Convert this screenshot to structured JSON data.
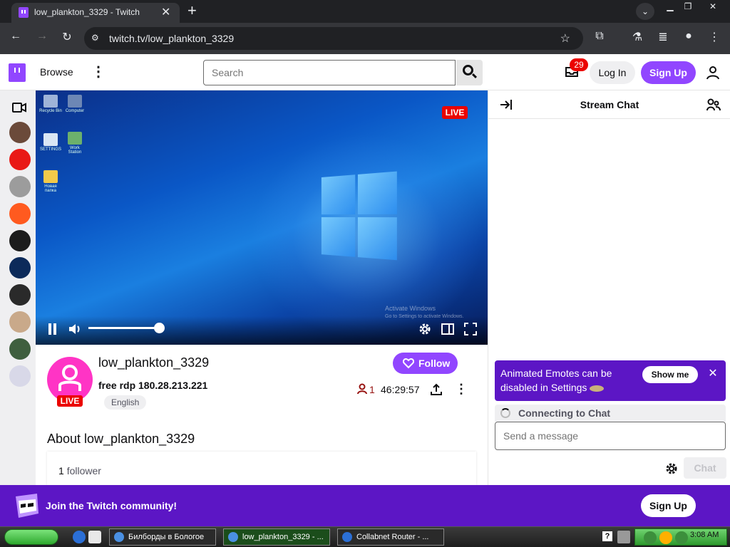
{
  "browser": {
    "tab_title": "low_plankton_3329 - Twitch",
    "url": "twitch.tv/low_plankton_3329"
  },
  "twitch_nav": {
    "browse_label": "Browse",
    "search_placeholder": "Search",
    "inbox_badge": "29",
    "login_label": "Log In",
    "signup_label": "Sign Up"
  },
  "sidebar": {
    "channels": [
      {
        "name": "channel-1",
        "color": "#6b4a3a"
      },
      {
        "name": "channel-2",
        "color": "#e91916"
      },
      {
        "name": "channel-3",
        "color": "#9c9c9c"
      },
      {
        "name": "channel-4",
        "color": "#ff5a1f"
      },
      {
        "name": "channel-5",
        "color": "#1c1c1c"
      },
      {
        "name": "channel-6",
        "color": "#0c2a5a"
      },
      {
        "name": "channel-7",
        "color": "#2a2a2a"
      },
      {
        "name": "channel-8",
        "color": "#c9a98a"
      },
      {
        "name": "channel-9",
        "color": "#3f5f3f"
      },
      {
        "name": "channel-10",
        "color": "#d8d8e8"
      }
    ]
  },
  "player": {
    "live_label": "LIVE",
    "activate_windows": "Activate Windows",
    "activate_hint": "Go to Settings to activate Windows.",
    "desktop_icons": [
      "Recycle Bin",
      "Computer",
      "SETTINGS",
      "Work Station",
      "Новая папка"
    ]
  },
  "channel": {
    "name": "low_plankton_3329",
    "live_label": "LIVE",
    "stream_title": "free rdp 180.28.213.221",
    "language": "English",
    "follow_label": "Follow",
    "viewers": "1",
    "uptime": "46:29:57",
    "about_title": "About low_plankton_3329",
    "follower_count": "1",
    "follower_label": "follower"
  },
  "chat": {
    "title": "Stream Chat",
    "banner_text": "Animated Emotes can be disabled in Settings",
    "show_me_label": "Show me",
    "connecting_text": "Connecting to Chat",
    "message_placeholder": "Send a message",
    "send_label": "Chat"
  },
  "join_banner": {
    "text": "Join the Twitch community!",
    "signup_label": "Sign Up"
  },
  "taskbar": {
    "tasks": [
      "Билборды в Бологое",
      "low_plankton_3329 - ...",
      "Collabnet Router - ..."
    ],
    "clock": "3:08 AM"
  },
  "colors": {
    "twitch_purple": "#9146ff",
    "banner_purple": "#5c16c5",
    "live_red": "#eb0400"
  }
}
